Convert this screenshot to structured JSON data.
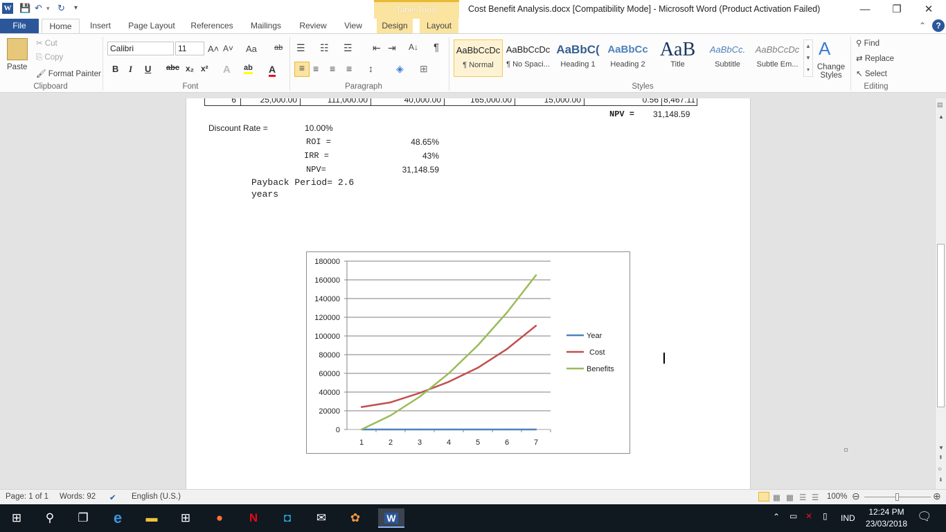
{
  "titlebar": {
    "qat": {
      "save": "💾",
      "undo": "↶",
      "undo_arrow": "▾",
      "redo": "↻",
      "customize": "▾"
    },
    "context_tab_group": "Table Tools",
    "title": "Cost Benefit Analysis.docx [Compatibility Mode]  -  Microsoft Word (Product Activation Failed)",
    "min": "—",
    "restore": "❐",
    "close": "✕"
  },
  "tabs": {
    "file": "File",
    "home": "Home",
    "insert": "Insert",
    "page_layout": "Page Layout",
    "references": "References",
    "mailings": "Mailings",
    "review": "Review",
    "view": "View",
    "design": "Design",
    "layout": "Layout",
    "collapse": "⌃",
    "help": "?"
  },
  "ribbon": {
    "clipboard": {
      "paste": "Paste",
      "cut": "Cut",
      "copy": "Copy",
      "format_painter": "Format Painter",
      "label": "Clipboard"
    },
    "font": {
      "family": "Calibri",
      "size": "11",
      "label": "Font",
      "grow": "A˄",
      "shrink": "A˅",
      "case": "Aa",
      "clear": "ab",
      "bold": "B",
      "italic": "I",
      "underline": "U",
      "strike": "abc",
      "sub": "x₂",
      "sup": "x²",
      "effects": "A",
      "highlight": "ab",
      "color": "A"
    },
    "paragraph": {
      "label": "Paragraph",
      "pilcrow": "¶",
      "sort": "A↓"
    },
    "styles": {
      "label": "Styles",
      "items": [
        {
          "preview": "AaBbCcDc",
          "name": "¶ Normal"
        },
        {
          "preview": "AaBbCcDc",
          "name": "¶ No Spaci..."
        },
        {
          "preview": "AaBbC(",
          "name": "Heading 1"
        },
        {
          "preview": "AaBbCc",
          "name": "Heading 2"
        },
        {
          "preview": "AaB",
          "name": "Title"
        },
        {
          "preview": "AaBbCc.",
          "name": "Subtitle"
        },
        {
          "preview": "AaBbCcDc",
          "name": "Subtle Em..."
        }
      ],
      "change_styles": "Change Styles"
    },
    "editing": {
      "find": "Find",
      "replace": "Replace",
      "select": "Select",
      "label": "Editing"
    }
  },
  "document": {
    "table_row": [
      "6",
      "25,000.00",
      "111,000.00",
      "40,000.00",
      "165,000.00",
      "15,000.00",
      "0.56",
      "8,467.11"
    ],
    "npv_label": "NPV  =",
    "npv_value": "31,148.59",
    "discount_rate_label": "Discount Rate =",
    "discount_rate_value": "10.00%",
    "roi_label": "ROI  =",
    "roi_value": "48.65%",
    "irr_label": "IRR  =",
    "irr_value": "43%",
    "npv2_label": "NPV=",
    "npv2_value": "31,148.59",
    "payback_line1": "Payback Period= 2.6",
    "payback_line2": "years"
  },
  "chart_data": {
    "type": "line",
    "x": [
      1,
      2,
      3,
      4,
      5,
      6,
      7
    ],
    "ylim": [
      0,
      180000
    ],
    "yticks": [
      "0",
      "20000",
      "40000",
      "60000",
      "80000",
      "100000",
      "120000",
      "140000",
      "160000",
      "180000"
    ],
    "xticks": [
      "1",
      "2",
      "3",
      "4",
      "5",
      "6",
      "7"
    ],
    "legend_position": "right",
    "grid": true,
    "series": [
      {
        "name": "Year",
        "color": "#4f81bd",
        "values": [
          1,
          2,
          3,
          4,
          5,
          6,
          7
        ]
      },
      {
        "name": "Cost",
        "color": "#c0504d",
        "values": [
          24000,
          29000,
          39000,
          51000,
          66000,
          86000,
          111000
        ]
      },
      {
        "name": "Benefits",
        "color": "#9bbb59",
        "values": [
          0,
          15000,
          35000,
          60000,
          90000,
          125000,
          165000
        ]
      }
    ]
  },
  "statusbar": {
    "page": "Page: 1 of 1",
    "words": "Words: 92",
    "language": "English (U.S.)",
    "zoom": "100%"
  },
  "taskbar": {
    "lang": "IND",
    "time": "12:24 PM",
    "date": "23/03/2018"
  }
}
